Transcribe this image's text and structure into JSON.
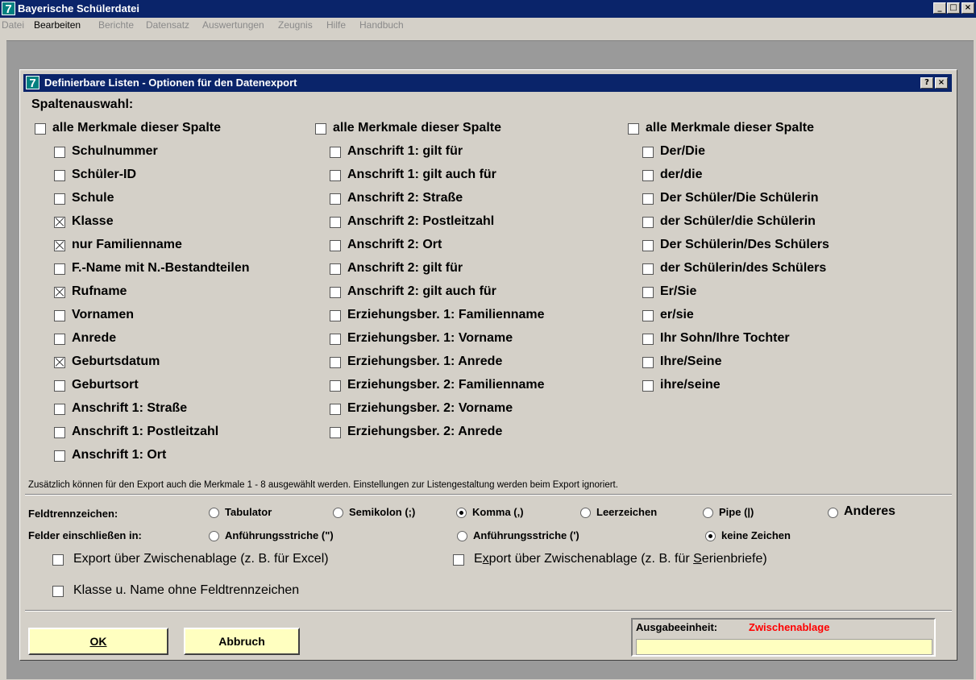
{
  "window": {
    "title": "Bayerische Schülerdatei",
    "icon": "7"
  },
  "menubar": [
    {
      "label": "Datei",
      "enabled": false
    },
    {
      "label": "Bearbeiten",
      "enabled": true
    },
    {
      "label": "Berichte",
      "enabled": false
    },
    {
      "label": "Datensatz",
      "enabled": false
    },
    {
      "label": "Auswertungen",
      "enabled": false
    },
    {
      "label": "Zeugnis",
      "enabled": false
    },
    {
      "label": "Hilfe",
      "enabled": false
    },
    {
      "label": "Handbuch",
      "enabled": false
    }
  ],
  "dialog": {
    "title": "Definierbare Listen - Optionen für den Datenexport",
    "help_label": "?",
    "close_label": "×",
    "section_label": "Spaltenauswahl:",
    "columns": [
      {
        "all_label": "alle Merkmale dieser Spalte",
        "all_checked": false,
        "items": [
          {
            "label": "Schulnummer",
            "checked": false
          },
          {
            "label": "Schüler-ID",
            "checked": false
          },
          {
            "label": "Schule",
            "checked": false
          },
          {
            "label": "Klasse",
            "checked": true
          },
          {
            "label": "nur Familienname",
            "checked": true
          },
          {
            "label": "F.-Name mit N.-Bestandteilen",
            "checked": false
          },
          {
            "label": "Rufname",
            "checked": true
          },
          {
            "label": "Vornamen",
            "checked": false
          },
          {
            "label": "Anrede",
            "checked": false
          },
          {
            "label": "Geburtsdatum",
            "checked": true
          },
          {
            "label": "Geburtsort",
            "checked": false
          },
          {
            "label": "Anschrift 1: Straße",
            "checked": false
          },
          {
            "label": "Anschrift 1: Postleitzahl",
            "checked": false
          },
          {
            "label": "Anschrift 1: Ort",
            "checked": false
          }
        ]
      },
      {
        "all_label": "alle Merkmale dieser Spalte",
        "all_checked": false,
        "items": [
          {
            "label": "Anschrift 1: gilt für",
            "checked": false
          },
          {
            "label": "Anschrift 1: gilt auch für",
            "checked": false
          },
          {
            "label": "Anschrift 2: Straße",
            "checked": false
          },
          {
            "label": "Anschrift 2: Postleitzahl",
            "checked": false
          },
          {
            "label": "Anschrift 2: Ort",
            "checked": false
          },
          {
            "label": "Anschrift 2: gilt für",
            "checked": false
          },
          {
            "label": "Anschrift 2: gilt auch für",
            "checked": false
          },
          {
            "label": "Erziehungsber. 1: Familienname",
            "checked": false
          },
          {
            "label": "Erziehungsber. 1: Vorname",
            "checked": false
          },
          {
            "label": "Erziehungsber. 1: Anrede",
            "checked": false
          },
          {
            "label": "Erziehungsber. 2: Familienname",
            "checked": false
          },
          {
            "label": "Erziehungsber. 2: Vorname",
            "checked": false
          },
          {
            "label": "Erziehungsber. 2: Anrede",
            "checked": false
          }
        ]
      },
      {
        "all_label": "alle Merkmale dieser Spalte",
        "all_checked": false,
        "items": [
          {
            "label": "Der/Die",
            "checked": false
          },
          {
            "label": "der/die",
            "checked": false
          },
          {
            "label": "Der Schüler/Die Schülerin",
            "checked": false
          },
          {
            "label": "der Schüler/die Schülerin",
            "checked": false
          },
          {
            "label": "Der Schülerin/Des Schülers",
            "checked": false
          },
          {
            "label": "der Schülerin/des Schülers",
            "checked": false
          },
          {
            "label": "Er/Sie",
            "checked": false
          },
          {
            "label": "er/sie",
            "checked": false
          },
          {
            "label": "Ihr Sohn/Ihre Tochter",
            "checked": false
          },
          {
            "label": "Ihre/Seine",
            "checked": false
          },
          {
            "label": "ihre/seine",
            "checked": false
          }
        ]
      }
    ],
    "note": "Zusätzlich können für den Export auch die Merkmale 1 - 8 ausgewählt werden. Einstellungen zur Listengestaltung werden beim Export ignoriert.",
    "delimiter": {
      "label": "Feldtrennzeichen:",
      "options": [
        {
          "label": "Tabulator",
          "checked": false
        },
        {
          "label": "Semikolon (;)",
          "checked": false
        },
        {
          "label": "Komma (,)",
          "checked": true
        },
        {
          "label": "Leerzeichen",
          "checked": false
        },
        {
          "label": "Pipe (|)",
          "checked": false
        },
        {
          "label": "Anderes",
          "checked": false
        }
      ]
    },
    "enclose": {
      "label": "Felder einschließen in:",
      "options": [
        {
          "label": "Anführungsstriche (\")",
          "checked": false
        },
        {
          "label": "Anführungsstriche (')",
          "checked": false
        },
        {
          "label": "keine Zeichen",
          "checked": true
        }
      ]
    },
    "export_excel": {
      "label": "Export über Zwischenablage (z. B. für Excel)",
      "checked": false
    },
    "export_serien": {
      "label_pre": "E",
      "label_u1": "x",
      "label_mid": "port über Zwischenablage (z. B. für ",
      "label_u2": "S",
      "label_post": "erienbriefe)",
      "checked": false
    },
    "klasse_name": {
      "label": "Klasse u. Name ohne Feldtrennzeichen",
      "checked": false
    },
    "ok_label": "OK",
    "cancel_label": "Abbruch",
    "output": {
      "label": "Ausgabeeinheit:",
      "value": "Zwischenablage",
      "value_color": "#ff0000"
    }
  }
}
